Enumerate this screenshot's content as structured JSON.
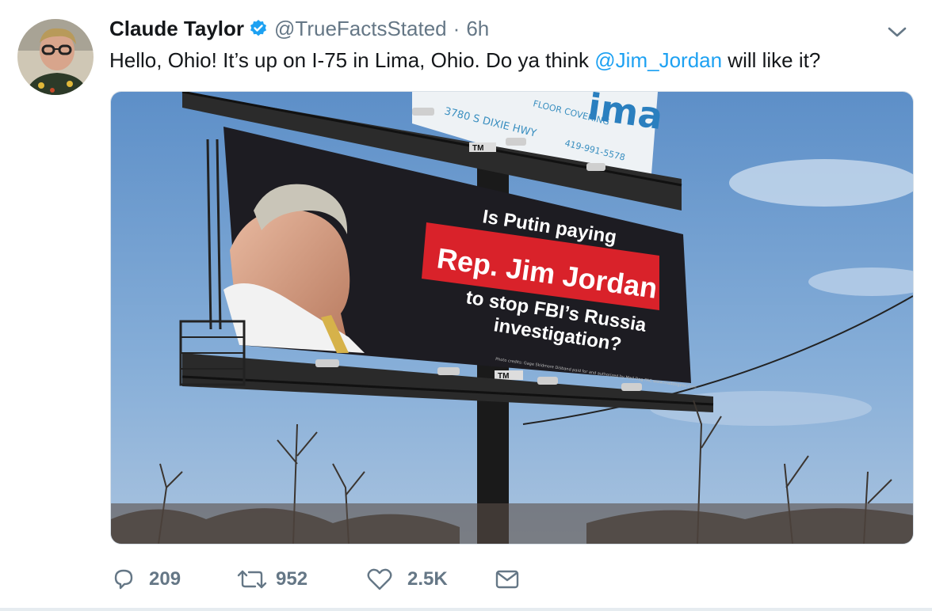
{
  "tweet": {
    "author_name": "Claude Taylor",
    "handle": "@TrueFactsStated",
    "separator": "·",
    "time": "6h",
    "text_part1": "Hello, Ohio! It’s up on I-75 in Lima, Ohio. Do ya think ",
    "mention": "@Jim_Jordan",
    "text_part2": " will like it?"
  },
  "billboard": {
    "line1": "Is Putin paying",
    "highlight": "Rep. Jim Jordan",
    "line2": "to stop FBI’s Russia",
    "line3": "investigation?",
    "credit": "Photo credits: Gage Skidmore   Disband paid for and authorized by Mad Dog PAC  www.maddogpac.com",
    "tm1": "TM",
    "tm2": "TM"
  },
  "upper_billboard": {
    "brand": "ima",
    "tagline": "FLOOR COVERING",
    "address": "3780 S DIXIE HWY",
    "phone": "419-991-5578"
  },
  "actions": {
    "replies": "209",
    "retweets": "952",
    "likes": "2.5K"
  },
  "colors": {
    "link": "#1da1f2",
    "muted": "#657786",
    "verified": "#1da1f2",
    "billboard_red": "#d9222a"
  },
  "icons": [
    "verified-badge-icon",
    "chevron-down-icon",
    "reply-icon",
    "retweet-icon",
    "like-icon",
    "direct-message-icon"
  ]
}
